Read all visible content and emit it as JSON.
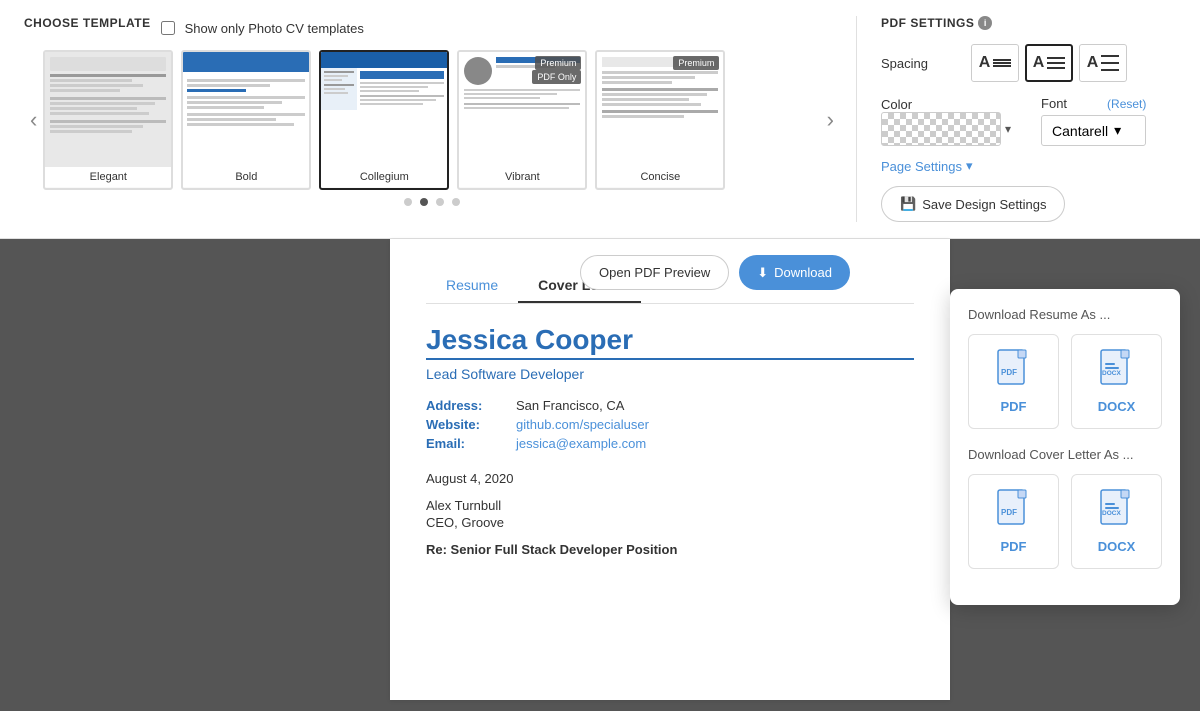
{
  "header": {
    "choose_template_label": "CHOOSE TEMPLATE",
    "show_photo_cv_label": "Show only Photo CV templates",
    "nav_prev": "‹",
    "nav_next": "›",
    "templates": [
      {
        "id": "elegant",
        "label": "Elegant",
        "premium": false,
        "selected": false
      },
      {
        "id": "bold",
        "label": "Bold",
        "premium": false,
        "selected": false
      },
      {
        "id": "collegium",
        "label": "Collegium",
        "premium": false,
        "selected": true
      },
      {
        "id": "vibrant",
        "label": "Vibrant",
        "premium": true,
        "pdf_only": true,
        "selected": false
      },
      {
        "id": "concise",
        "label": "Concise",
        "premium": true,
        "selected": false
      }
    ],
    "dots": [
      {
        "active": false
      },
      {
        "active": true
      },
      {
        "active": false
      },
      {
        "active": false
      }
    ]
  },
  "pdf_settings": {
    "title": "PDF SETTINGS",
    "spacing_label": "Spacing",
    "spacing_options": [
      {
        "id": "compact",
        "active": false
      },
      {
        "id": "normal",
        "active": true
      },
      {
        "id": "wide",
        "active": false
      }
    ],
    "color_label": "Color",
    "font_label": "Font",
    "font_reset_label": "(Reset)",
    "font_value": "Cantarell",
    "page_settings_label": "Page Settings",
    "save_button_label": "Save Design Settings"
  },
  "action_bar": {
    "open_pdf_label": "Open PDF Preview",
    "download_label": "Download"
  },
  "download_dropdown": {
    "resume_section_title": "Download Resume As ...",
    "cover_letter_section_title": "Download Cover Letter As ...",
    "pdf_label": "PDF",
    "docx_label": "DOCX"
  },
  "preview": {
    "tab_resume": "Resume",
    "tab_cover_letter": "Cover Letter",
    "name": "Jessica Cooper",
    "title": "Lead Software Developer",
    "address_label": "Address:",
    "address_value": "San Francisco, CA",
    "website_label": "Website:",
    "website_value": "github.com/specialuser",
    "email_label": "Email:",
    "email_value": "jessica@example.com",
    "date": "August 4, 2020",
    "recipient_name": "Alex Turnbull",
    "recipient_title": "CEO, Groove",
    "re_line": "Re: Senior Full Stack Developer Position"
  }
}
